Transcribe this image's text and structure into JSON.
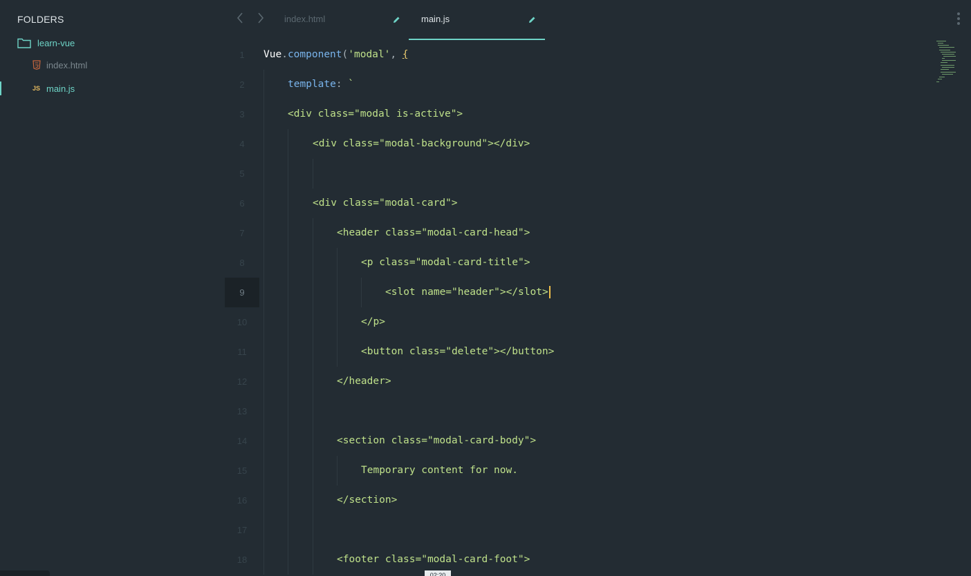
{
  "sidebar": {
    "title": "FOLDERS",
    "folder": {
      "label": "learn-vue"
    },
    "files": [
      {
        "label": "index.html"
      },
      {
        "label": "main.js",
        "icon_text": "JS"
      }
    ]
  },
  "tabs": [
    {
      "label": "index.html"
    },
    {
      "label": "main.js"
    }
  ],
  "editor": {
    "line_numbers": [
      "1",
      "2",
      "3",
      "4",
      "5",
      "6",
      "7",
      "8",
      "9",
      "10",
      "11",
      "12",
      "13",
      "14",
      "15",
      "16",
      "17",
      "18"
    ],
    "current_line": "9",
    "lines": {
      "l1": {
        "obj": "Vue",
        "dot": ".",
        "fn": "component",
        "open": "(",
        "str": "'modal'",
        "comma": ", ",
        "brace": "{"
      },
      "l2": {
        "key": "template",
        "colon": ":",
        "tick": " `"
      },
      "l3": "<div class=\"modal is-active\">",
      "l4": "<div class=\"modal-background\"></div>",
      "l6": "<div class=\"modal-card\">",
      "l7": "<header class=\"modal-card-head\">",
      "l8": "<p class=\"modal-card-title\">",
      "l9": "<slot name=\"header\"></slot>",
      "l10": "</p>",
      "l11": "<button class=\"delete\"></button>",
      "l12": "</header>",
      "l14": "<section class=\"modal-card-body\">",
      "l15": "Temporary content for now.",
      "l16": "</section>",
      "l18": "<footer class=\"modal-card-foot\">"
    }
  },
  "status": {
    "time": "02:20"
  },
  "colors": {
    "background": "#232c33",
    "accent": "#6ed4c7",
    "string": "#bfe18a",
    "function": "#79b4ec",
    "cursor": "#f0c04a"
  },
  "icons": {
    "folder": "folder-icon",
    "html_file": "html5-file-icon",
    "js_file": "js-file-icon",
    "back": "chevron-left-icon",
    "forward": "chevron-right-icon",
    "edit": "pencil-icon",
    "more": "kebab-menu-icon"
  }
}
